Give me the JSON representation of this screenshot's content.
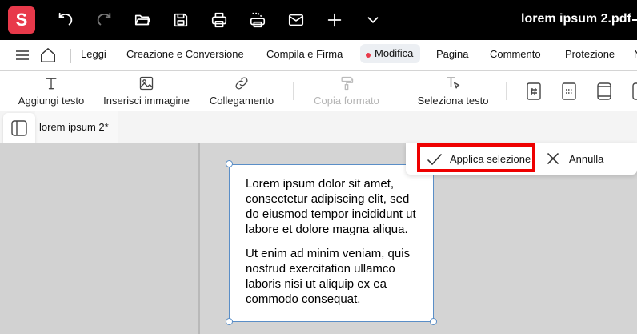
{
  "app": {
    "logo_letter": "S",
    "document_title": "lorem ipsum 2.pdf"
  },
  "titlebar_icons": [
    "undo-icon",
    "redo-icon",
    "folder-open-icon",
    "save-icon",
    "print-icon",
    "scan-print-icon",
    "email-icon",
    "plus-icon",
    "chevron-down-icon"
  ],
  "menu": {
    "items": [
      {
        "label": "Leggi"
      },
      {
        "label": "Creazione e Conversione"
      },
      {
        "label": "Compila e Firma"
      },
      {
        "label": "Modifica",
        "active": true
      },
      {
        "label": "Pagina"
      },
      {
        "label": "Commento"
      },
      {
        "label": "Protezione"
      }
    ],
    "overflow": "N"
  },
  "toolbar": {
    "tools": [
      {
        "label": "Aggiungi testo",
        "icon": "text-icon"
      },
      {
        "label": "Inserisci immagine",
        "icon": "image-icon"
      },
      {
        "label": "Collegamento",
        "icon": "link-icon"
      },
      {
        "label": "Copia formato",
        "icon": "format-painter-icon",
        "disabled": true
      },
      {
        "label": "Seleziona testo",
        "icon": "select-text-icon"
      }
    ]
  },
  "tabs": {
    "document_tab": "lorem ipsum 2*"
  },
  "selection_popup": {
    "apply_label": "Applica selezione",
    "cancel_label": "Annulla"
  },
  "textbox": {
    "paragraph_1": "Lorem ipsum dolor sit amet, consectetur adipiscing elit, sed do eiusmod tempor incididunt ut labore et dolore magna aliqua.",
    "paragraph_2": "Ut enim ad minim veniam, quis nostrud exercitation ullamco laboris nisi ut aliquip ex ea commodo consequat."
  },
  "colors": {
    "brand": "#e8394a",
    "highlight_border": "#e00000",
    "selection_border": "#5a8ec7"
  }
}
